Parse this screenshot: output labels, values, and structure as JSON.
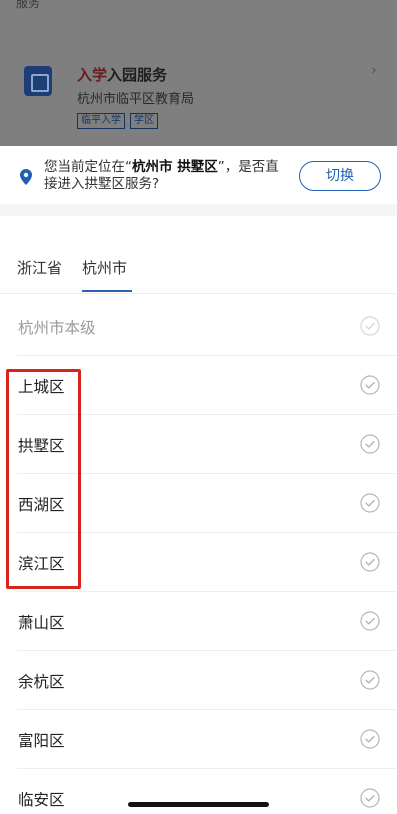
{
  "background_app": {
    "top_text": "服务",
    "card": {
      "title_red": "入学",
      "title_rest": "入园服务",
      "subtitle": "杭州市临平区教育局",
      "tags": [
        "临平入学",
        "学区"
      ],
      "chevron": "›"
    }
  },
  "location_prompt": {
    "text_before": "您当前定位在“",
    "highlight": "杭州市 拱墅区",
    "text_after": "”，是否直接进入拱墅区服务?",
    "switch_label": "切换"
  },
  "tabs": [
    {
      "label": "浙江省",
      "active": false
    },
    {
      "label": "杭州市",
      "active": true
    }
  ],
  "districts": [
    {
      "label": "杭州市本级",
      "disabled": true
    },
    {
      "label": "上城区",
      "disabled": false
    },
    {
      "label": "拱墅区",
      "disabled": false
    },
    {
      "label": "西湖区",
      "disabled": false
    },
    {
      "label": "滨江区",
      "disabled": false
    },
    {
      "label": "萧山区",
      "disabled": false
    },
    {
      "label": "余杭区",
      "disabled": false
    },
    {
      "label": "富阳区",
      "disabled": false
    },
    {
      "label": "临安区",
      "disabled": false
    }
  ],
  "colors": {
    "accent": "#1f5fb4",
    "highlight_box": "#d9241b",
    "check_icon": "#b5b5b5"
  },
  "icons": {
    "location": "location-pin-icon",
    "check": "check-circle-icon",
    "chevron": "chevron-right-icon"
  }
}
